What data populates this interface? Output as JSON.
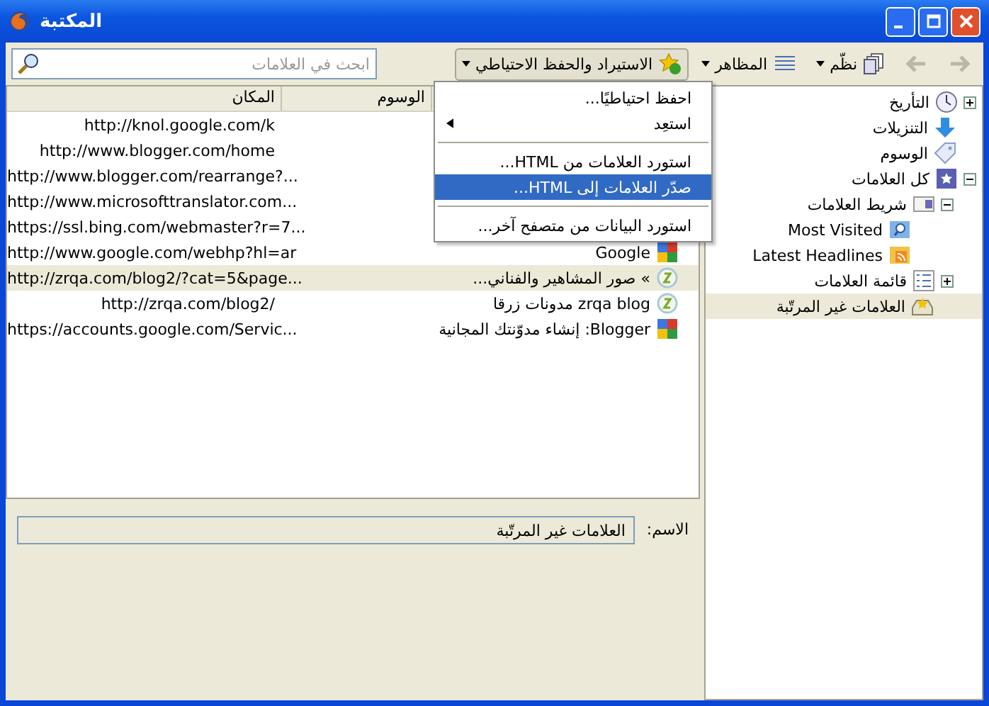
{
  "window": {
    "title": "المكتبة"
  },
  "toolbar": {
    "back_disabled": true,
    "forward_disabled": true,
    "organize": "نظّم",
    "views": "المظاهر",
    "import_backup": {
      "label": "الاستيراد والحفظ الاحتياطي",
      "pressed": true
    },
    "search": {
      "placeholder": "ابحث في العلامات"
    }
  },
  "menu": [
    {
      "kind": "item",
      "label": "احفظ احتياطيًا...",
      "selected": false
    },
    {
      "kind": "submenu",
      "label": "استعِد",
      "selected": false
    },
    {
      "kind": "separator"
    },
    {
      "kind": "item",
      "label": "استورد العلامات من HTML...",
      "selected": false
    },
    {
      "kind": "item",
      "label": "صدّر العلامات إلى HTML...",
      "selected": true
    },
    {
      "kind": "separator"
    },
    {
      "kind": "item",
      "label": "استورد البيانات من متصفح آخر...",
      "selected": false
    }
  ],
  "tree": [
    {
      "kind": "history",
      "label": "التأريخ",
      "expanded": false,
      "selected": false
    },
    {
      "kind": "downloads",
      "label": "التنزيلات",
      "selected": false
    },
    {
      "kind": "tags",
      "label": "الوسوم",
      "selected": false
    },
    {
      "kind": "all",
      "label": "كل العلامات",
      "expanded": true,
      "selected": false,
      "children": [
        {
          "kind": "toolbar",
          "label": "شريط العلامات",
          "expanded": true,
          "selected": false,
          "children": [
            {
              "kind": "smart",
              "label": "Most Visited",
              "selected": false
            },
            {
              "kind": "feed",
              "label": "Latest Headlines",
              "selected": false
            }
          ]
        },
        {
          "kind": "menu",
          "label": "قائمة العلامات",
          "expanded": false,
          "selected": false
        },
        {
          "kind": "unsorted",
          "label": "العلامات غير المرتّبة",
          "selected": true
        }
      ]
    }
  ],
  "table": {
    "columns": [
      "الوسوم",
      "المكان"
    ],
    "rows": [
      {
        "location": "http://knol.google.com/k",
        "selected": false
      },
      {
        "location": "http://www.blogger.com/home",
        "selected": false
      },
      {
        "location": "http://www.blogger.com/rearrange?...",
        "selected": false
      },
      {
        "location": "http://www.microsofttranslator.com...",
        "selected": false
      },
      {
        "location": "https://ssl.bing.com/webmaster?r=7...",
        "selected": false
      },
      {
        "kind": "google",
        "name": "Google",
        "location": "http://www.google.com/webhp?hl=ar",
        "selected": false
      },
      {
        "kind": "zrqa",
        "name": "» صور المشاهير والفناني...",
        "location": "http://zrqa.com/blog2/?cat=5&page...",
        "selected": true
      },
      {
        "kind": "zrqa",
        "name": "zrqa blog مدونات زرقا",
        "location": "http://zrqa.com/blog2/",
        "selected": false
      },
      {
        "kind": "google",
        "name": "Blogger: إنشاء مدوّنتك المجانية",
        "location": "https://accounts.google.com/Servic...",
        "selected": false
      }
    ]
  },
  "details": {
    "name_label": "الاسم:",
    "name_value": "العلامات غير المرتّبة"
  }
}
